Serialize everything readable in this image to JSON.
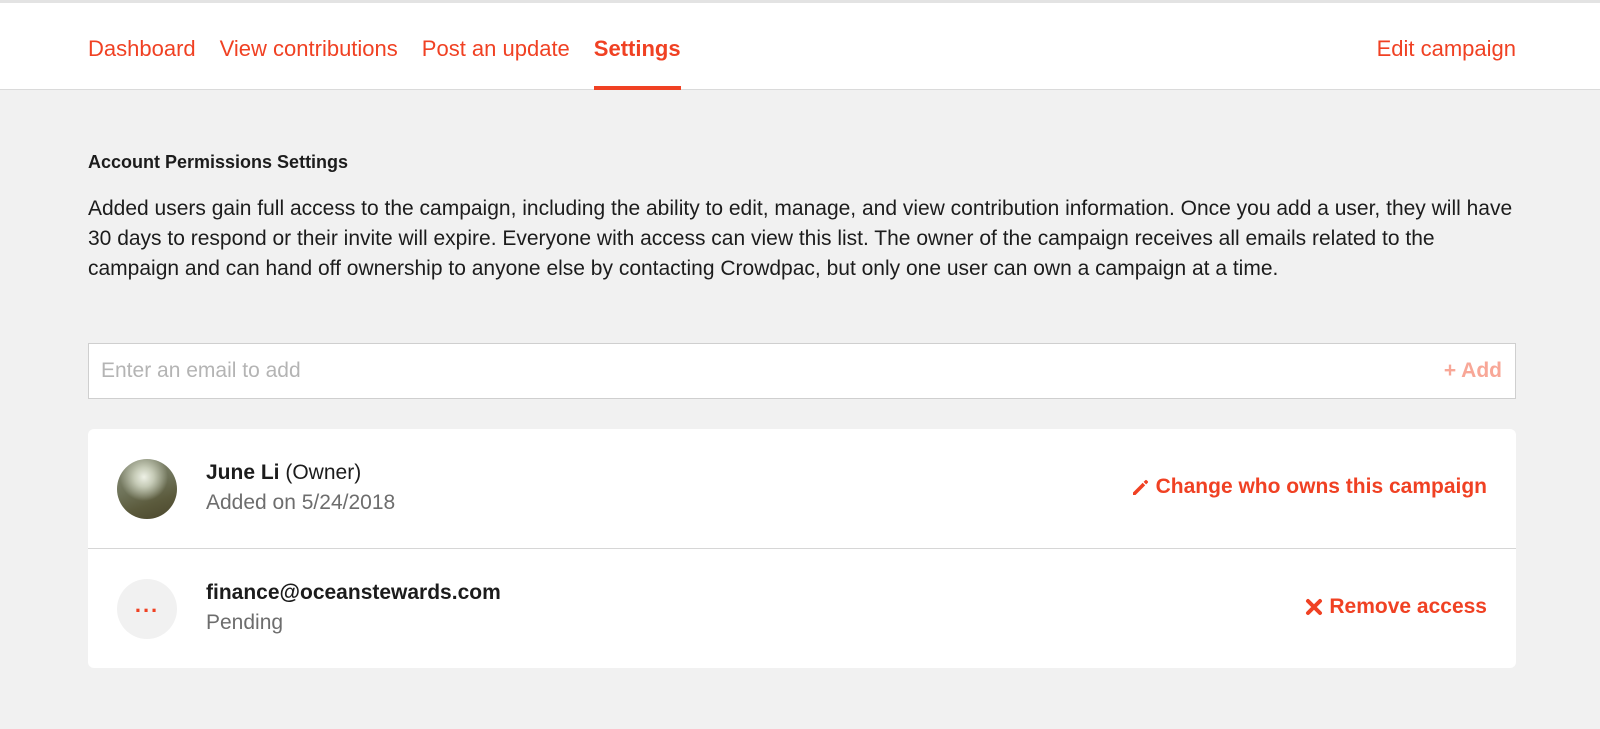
{
  "nav": {
    "tabs": [
      {
        "label": "Dashboard",
        "active": false
      },
      {
        "label": "View contributions",
        "active": false
      },
      {
        "label": "Post an update",
        "active": false
      },
      {
        "label": "Settings",
        "active": true
      }
    ],
    "edit_campaign": "Edit campaign"
  },
  "permissions": {
    "title": "Account Permissions Settings",
    "description": "Added users gain full access to the campaign, including the ability to edit, manage, and view contribution information. Once you add a user, they will have 30 days to respond or their invite will expire. Everyone with access can view this list. The owner of the campaign receives all emails related to the campaign and can hand off ownership to anyone else by contacting Crowdpac, but only one user can own a campaign at a time.",
    "email_input": {
      "placeholder": "Enter an email to add",
      "value": ""
    },
    "add_label": "+ Add"
  },
  "users": [
    {
      "name": "June Li",
      "role": "(Owner)",
      "subtext": "Added on 5/24/2018",
      "avatar_icon": "user-photo",
      "action_icon": "pencil-icon",
      "action_label": "Change who owns this campaign"
    },
    {
      "name": "finance@oceanstewards.com",
      "role": "",
      "subtext": "Pending",
      "avatar_icon": "ellipsis",
      "avatar_text": "...",
      "action_icon": "x-icon",
      "action_label": "Remove access"
    }
  ],
  "colors": {
    "accent": "#f04123",
    "accent_light": "#f8a797",
    "background": "#f1f1f1",
    "muted_text": "#6d6d6d"
  }
}
